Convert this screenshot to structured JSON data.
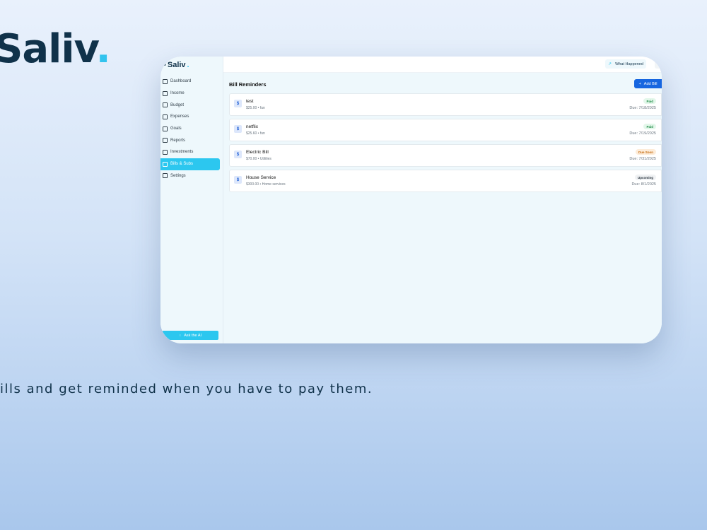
{
  "brand": {
    "name": "Saliv",
    "dot": "."
  },
  "tagline": "ills and get reminded when you have to pay them.",
  "app": {
    "logo": {
      "name": "Saliv",
      "dot": "."
    },
    "sidebar": {
      "items": [
        {
          "label": "Dashboard",
          "icon": "home-icon",
          "active": false
        },
        {
          "label": "Income",
          "icon": "dollar-icon",
          "active": false
        },
        {
          "label": "Budget",
          "icon": "pie-icon",
          "active": false
        },
        {
          "label": "Expenses",
          "icon": "card-icon",
          "active": false
        },
        {
          "label": "Goals",
          "icon": "target-icon",
          "active": false
        },
        {
          "label": "Reports",
          "icon": "chart-icon",
          "active": false
        },
        {
          "label": "Investments",
          "icon": "trend-icon",
          "active": false
        },
        {
          "label": "Bills & Subs",
          "icon": "calendar-icon",
          "active": true
        },
        {
          "label": "Settings",
          "icon": "gear-icon",
          "active": false
        }
      ],
      "ask_ai": "Ask the AI"
    },
    "topbar": {
      "what_happened": "What Happened"
    },
    "main": {
      "title": "Bill Reminders",
      "add_button": "Add Bill",
      "bills": [
        {
          "name": "test",
          "meta": "$25.00 • fun",
          "status": "Paid",
          "due": "Due: 7/18/2025"
        },
        {
          "name": "netflix",
          "meta": "$25.60 • fun",
          "status": "Paid",
          "due": "Due: 7/19/2025"
        },
        {
          "name": "Electric Bill",
          "meta": "$70.00 • Utilities",
          "status": "Due Soon",
          "due": "Due: 7/31/2025"
        },
        {
          "name": "House Service",
          "meta": "$300.00 • Home services",
          "status": "Upcoming",
          "due": "Due: 8/1/2025"
        }
      ]
    }
  },
  "colors": {
    "accent": "#2cc7ef",
    "primary_button": "#1766e0",
    "brand_text": "#10324a"
  }
}
